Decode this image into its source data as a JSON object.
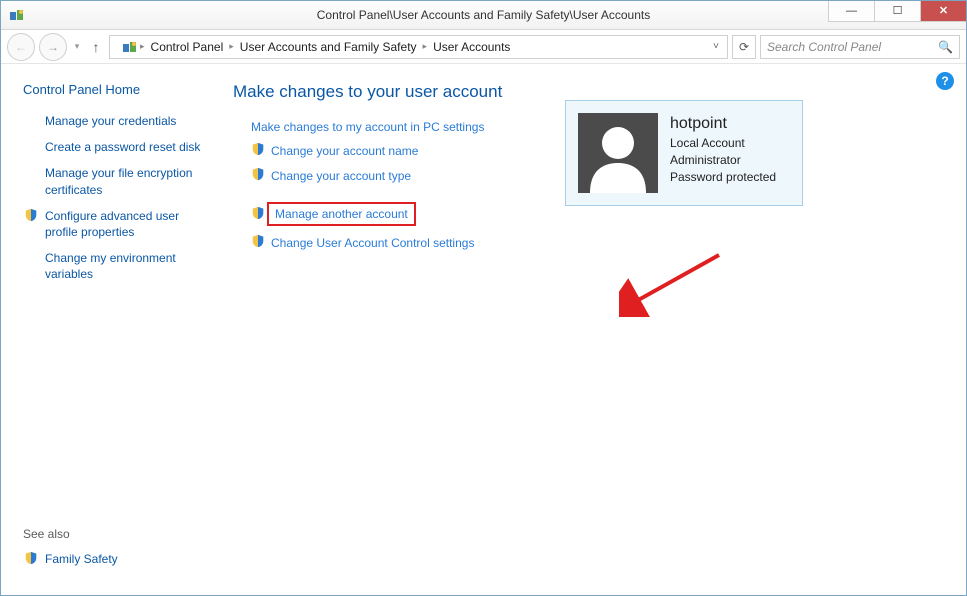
{
  "window": {
    "title": "Control Panel\\User Accounts and Family Safety\\User Accounts"
  },
  "breadcrumb": {
    "seg1": "Control Panel",
    "seg2": "User Accounts and Family Safety",
    "seg3": "User Accounts"
  },
  "search": {
    "placeholder": "Search Control Panel"
  },
  "sidebar": {
    "home": "Control Panel Home",
    "links": [
      {
        "label": "Manage your credentials",
        "shield": false
      },
      {
        "label": "Create a password reset disk",
        "shield": false
      },
      {
        "label": "Manage your file encryption certificates",
        "shield": false
      },
      {
        "label": "Configure advanced user profile properties",
        "shield": true
      },
      {
        "label": "Change my environment variables",
        "shield": false
      }
    ],
    "see_also": "See also",
    "family_safety": "Family Safety"
  },
  "main": {
    "heading": "Make changes to your user account",
    "top_link": "Make changes to my account in PC settings",
    "group1": [
      {
        "label": "Change your account name",
        "shield": true
      },
      {
        "label": "Change your account type",
        "shield": true
      }
    ],
    "group2": [
      {
        "label": "Manage another account",
        "shield": true,
        "highlight": true
      },
      {
        "label": "Change User Account Control settings",
        "shield": true
      }
    ]
  },
  "account": {
    "name": "hotpoint",
    "type": "Local Account",
    "role": "Administrator",
    "pw": "Password protected"
  }
}
